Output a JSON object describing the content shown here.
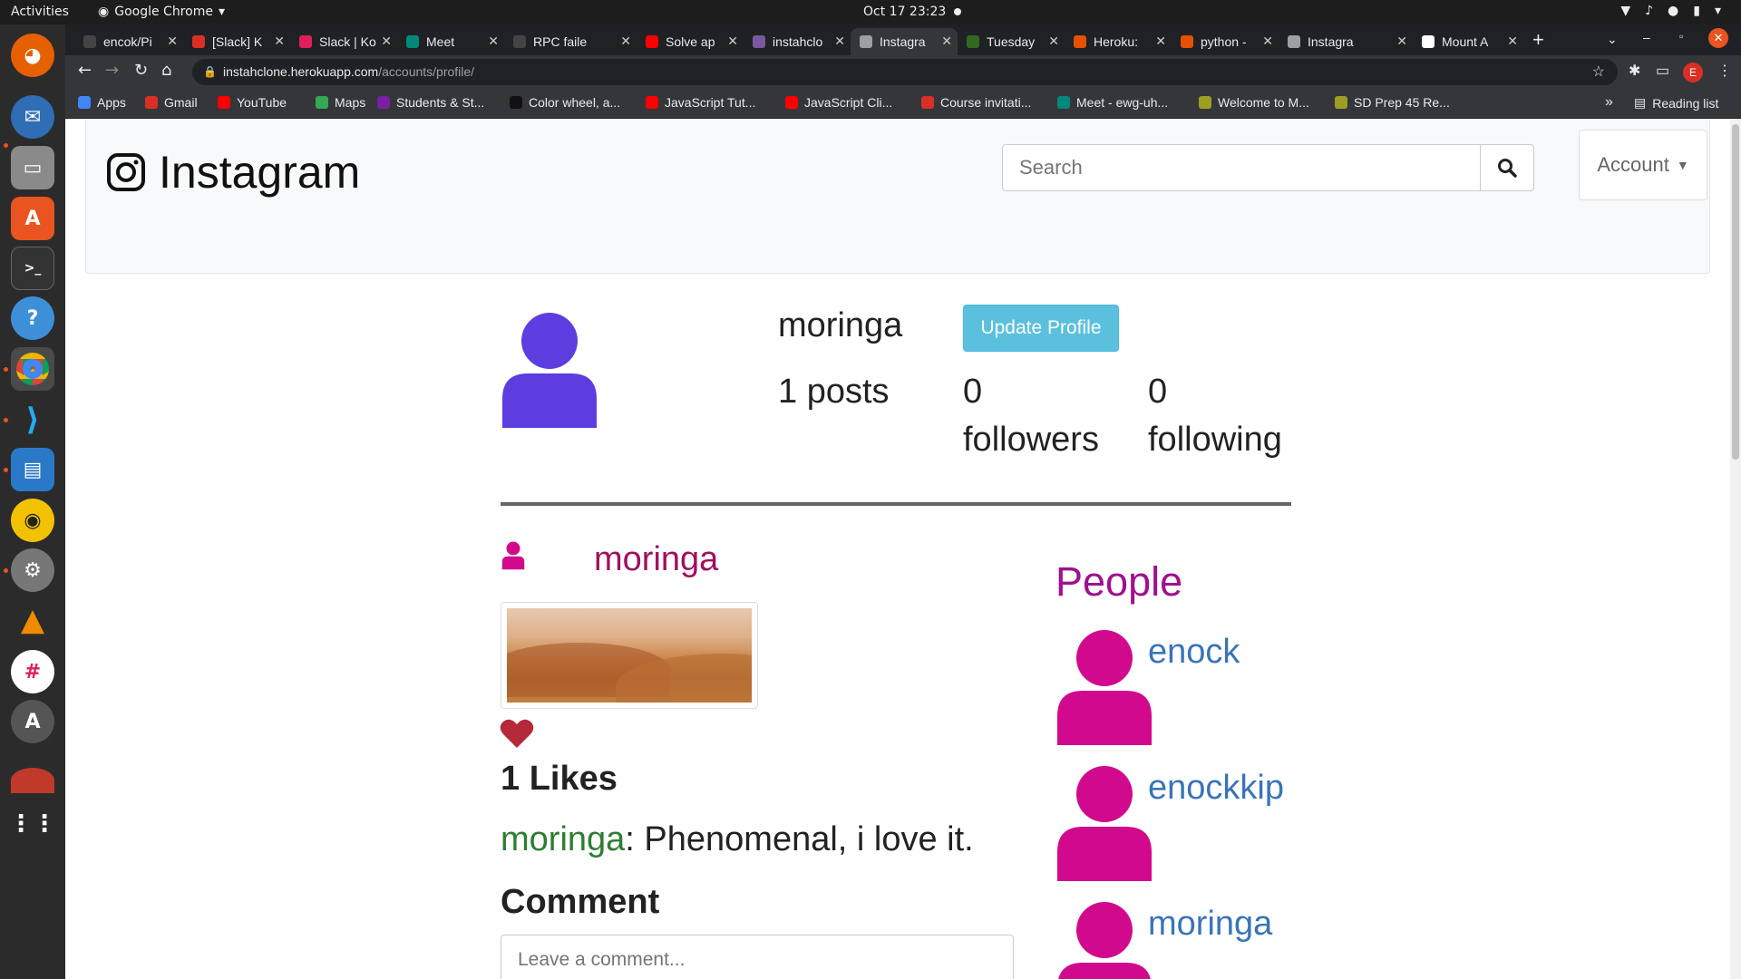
{
  "os_topbar": {
    "activities": "Activities",
    "app_name": "Google Chrome",
    "clock": "Oct 17  23:23"
  },
  "browser": {
    "tabs": [
      {
        "label": "encok/Pi",
        "favicon_color": "#444444"
      },
      {
        "label": "[Slack] K",
        "favicon_color": "#d93025"
      },
      {
        "label": "Slack | Ko",
        "favicon_color": "#e01e5a"
      },
      {
        "label": "Meet",
        "favicon_color": "#00897b"
      },
      {
        "label": "RPC faile",
        "favicon_color": "#444444"
      },
      {
        "label": "Solve ap",
        "favicon_color": "#ff0000"
      },
      {
        "label": "instahclo",
        "favicon_color": "#79589f"
      },
      {
        "label": "Instagra",
        "favicon_color": "#9aa0a6"
      },
      {
        "label": "Tuesday",
        "favicon_color": "#33691e"
      },
      {
        "label": "Heroku:",
        "favicon_color": "#e65100"
      },
      {
        "label": "python -",
        "favicon_color": "#e65100"
      },
      {
        "label": "Instagra",
        "favicon_color": "#9aa0a6"
      },
      {
        "label": "Mount A",
        "favicon_color": "#ffffff"
      }
    ],
    "active_tab_index": 7,
    "address": {
      "host": "instahclone.herokuapp.com",
      "path": "/accounts/profile/"
    },
    "profile_initial": "E",
    "bookmarks": [
      {
        "label": "Apps",
        "icon_color": "#4285f4"
      },
      {
        "label": "Gmail",
        "icon_color": "#d93025"
      },
      {
        "label": "YouTube",
        "icon_color": "#ff0000"
      },
      {
        "label": "Maps",
        "icon_color": "#34a853"
      },
      {
        "label": "Students & St...",
        "icon_color": "#7b1fa2"
      },
      {
        "label": "Color wheel, a...",
        "icon_color": "#111111"
      },
      {
        "label": "JavaScript Tut...",
        "icon_color": "#ff0000"
      },
      {
        "label": "JavaScript Cli...",
        "icon_color": "#ff0000"
      },
      {
        "label": "Course invitati...",
        "icon_color": "#d93025"
      },
      {
        "label": "Meet - ewg-uh...",
        "icon_color": "#00897b"
      },
      {
        "label": "Welcome to M...",
        "icon_color": "#9e9d24"
      },
      {
        "label": "SD Prep 45 Re...",
        "icon_color": "#9e9d24"
      }
    ],
    "overflow": "»",
    "reading_list": "Reading list"
  },
  "page": {
    "brand": "Instagram",
    "search_placeholder": "Search",
    "account_label": "Account",
    "profile": {
      "username": "moringa",
      "update_button": "Update Profile",
      "posts_count": "1",
      "posts_label": "posts",
      "followers_count": "0",
      "followers_label": "followers",
      "following_count": "0",
      "following_label": "following"
    },
    "post": {
      "username": "moringa",
      "likes_text": "1 Likes",
      "comment_user": "moringa",
      "comment_text": ": Phenomenal, i love it.",
      "comment_heading": "Comment",
      "comment_placeholder": "Leave a comment..."
    },
    "people": {
      "heading": "People",
      "items": [
        {
          "name": "enock"
        },
        {
          "name": "enockkip"
        },
        {
          "name": "moringa"
        }
      ]
    },
    "colors": {
      "profile_avatar": "#5e3de0",
      "people_avatar": "#d10a8d",
      "post_user_icon": "#d10a8d",
      "heart": "#b52a3a",
      "update_button": "#5bc0de",
      "people_link": "#3a74b8"
    }
  }
}
